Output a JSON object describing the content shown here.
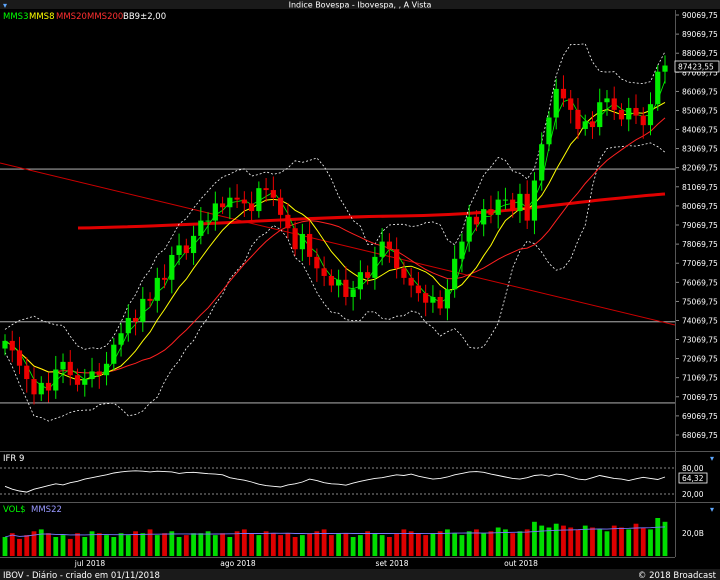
{
  "window": {
    "title": "Indice Bovespa - Ibovespa, , A Vista",
    "menu_icon": "chevron-down-icon"
  },
  "legend": {
    "items": [
      {
        "label": "MMS3",
        "color": "#00ff00"
      },
      {
        "label": "MMS8",
        "color": "#ffff00"
      },
      {
        "label": "MMS20",
        "color": "#ff0000"
      },
      {
        "label": "MMS200",
        "color": "#ff0000"
      },
      {
        "label": "BB9±2,00",
        "color": "#ffffff"
      }
    ]
  },
  "price_axis": {
    "labels": [
      "90069,75",
      "89069,75",
      "88069,75",
      "87069,75",
      "86069,75",
      "85069,75",
      "84069,75",
      "83069,75",
      "82069,75",
      "81069,75",
      "80069,75",
      "79069,75",
      "78069,75",
      "77069,75",
      "76069,75",
      "75069,75",
      "74069,75",
      "73069,75",
      "72069,75",
      "71069,75",
      "70069,75",
      "69069,75",
      "68069,75"
    ],
    "current": "87423,55"
  },
  "ifr": {
    "title": "IFR 9",
    "levels": [
      "80,00",
      "20,00"
    ],
    "current": "64,32"
  },
  "vol": {
    "title": "VOL$",
    "ma_label": "MMS22",
    "level": "20,0B"
  },
  "time_axis": {
    "labels": [
      "jul 2018",
      "ago 2018",
      "set 2018",
      "out 2018"
    ]
  },
  "footer": {
    "left": "IBOV - Diário - criado em 01/11/2018",
    "right": "© 2018 Broadcast"
  },
  "chart_data": {
    "type": "candlestick",
    "price_range": [
      67500,
      90500
    ],
    "horizontal_lines": [
      82000,
      74000,
      69750
    ],
    "closes": [
      73000,
      72500,
      71700,
      71000,
      70200,
      70800,
      70400,
      71500,
      71900,
      71200,
      70700,
      71000,
      71400,
      71200,
      71800,
      72800,
      73400,
      74200,
      74000,
      75200,
      75100,
      76300,
      76200,
      77500,
      78000,
      77600,
      78500,
      79300,
      79300,
      80200,
      80000,
      80500,
      80400,
      80200,
      79800,
      81000,
      80900,
      80500,
      79600,
      78900,
      77800,
      78600,
      77400,
      76800,
      76400,
      75900,
      76200,
      75300,
      75700,
      76600,
      76300,
      77400,
      78200,
      77800,
      76800,
      76300,
      75900,
      75500,
      75000,
      75300,
      74700,
      75700,
      77300,
      78200,
      79500,
      79100,
      79900,
      79600,
      80400,
      80400,
      79800,
      80700,
      79300,
      81400,
      83300,
      84700,
      86200,
      85700,
      85100,
      84100,
      84500,
      84200,
      85500,
      85700,
      85100,
      84600,
      85200,
      84800,
      84300,
      85400,
      87100,
      87423
    ],
    "opens": [
      72800,
      73000,
      72500,
      71700,
      71000,
      70200,
      70800,
      70400,
      71500,
      71900,
      71200,
      70700,
      71000,
      71400,
      71200,
      71800,
      72800,
      73400,
      74200,
      74000,
      75200,
      75100,
      76300,
      76200,
      77500,
      78000,
      77600,
      78500,
      79300,
      79300,
      80200,
      80000,
      80500,
      80400,
      80200,
      79800,
      81000,
      80900,
      80500,
      79600,
      78900,
      77800,
      78600,
      77400,
      76800,
      76400,
      75900,
      76200,
      75300,
      75700,
      76600,
      76300,
      77400,
      78200,
      77800,
      76800,
      76300,
      75900,
      75500,
      75000,
      75300,
      74700,
      75700,
      77300,
      78200,
      79500,
      79100,
      79900,
      79600,
      80400,
      80400,
      79800,
      80700,
      79300,
      81400,
      83300,
      84700,
      86200,
      85700,
      85100,
      84100,
      84500,
      84200,
      85500,
      85700,
      85100,
      84600,
      85200,
      84800,
      84300,
      85400,
      87100
    ],
    "ifr_values": [
      38,
      30,
      25,
      22,
      30,
      35,
      40,
      45,
      42,
      48,
      52,
      58,
      62,
      66,
      70,
      75,
      78,
      80,
      81,
      80,
      78,
      80,
      79,
      78,
      74,
      76,
      77,
      75,
      73,
      72,
      70,
      62,
      58,
      55,
      50,
      44,
      40,
      38,
      36,
      42,
      45,
      50,
      58,
      54,
      48,
      45,
      44,
      41,
      47,
      52,
      56,
      60,
      62,
      66,
      70,
      68,
      72,
      66,
      62,
      58,
      60,
      64,
      70,
      74,
      78,
      79,
      77,
      72,
      68,
      64,
      60,
      58,
      62,
      68,
      70,
      66,
      72,
      70,
      64,
      58,
      56,
      62,
      68,
      64,
      60,
      58,
      54,
      59,
      63,
      60,
      57,
      64
    ],
    "volume_values": [
      10,
      12,
      9,
      11,
      13,
      14,
      12,
      10,
      11,
      9,
      12,
      10,
      13,
      12,
      11,
      10,
      12,
      11,
      13,
      12,
      14,
      11,
      12,
      13,
      10,
      11,
      12,
      12,
      13,
      11,
      12,
      10,
      13,
      14,
      12,
      11,
      13,
      12,
      11,
      12,
      10,
      11,
      12,
      13,
      14,
      11,
      12,
      12,
      10,
      11,
      13,
      12,
      11,
      10,
      12,
      14,
      13,
      12,
      11,
      12,
      13,
      14,
      12,
      11,
      13,
      14,
      12,
      13,
      15,
      14,
      12,
      13,
      14,
      18,
      16,
      15,
      17,
      16,
      15,
      14,
      16,
      15,
      14,
      13,
      16,
      15,
      14,
      17,
      15,
      14,
      20,
      18
    ]
  }
}
